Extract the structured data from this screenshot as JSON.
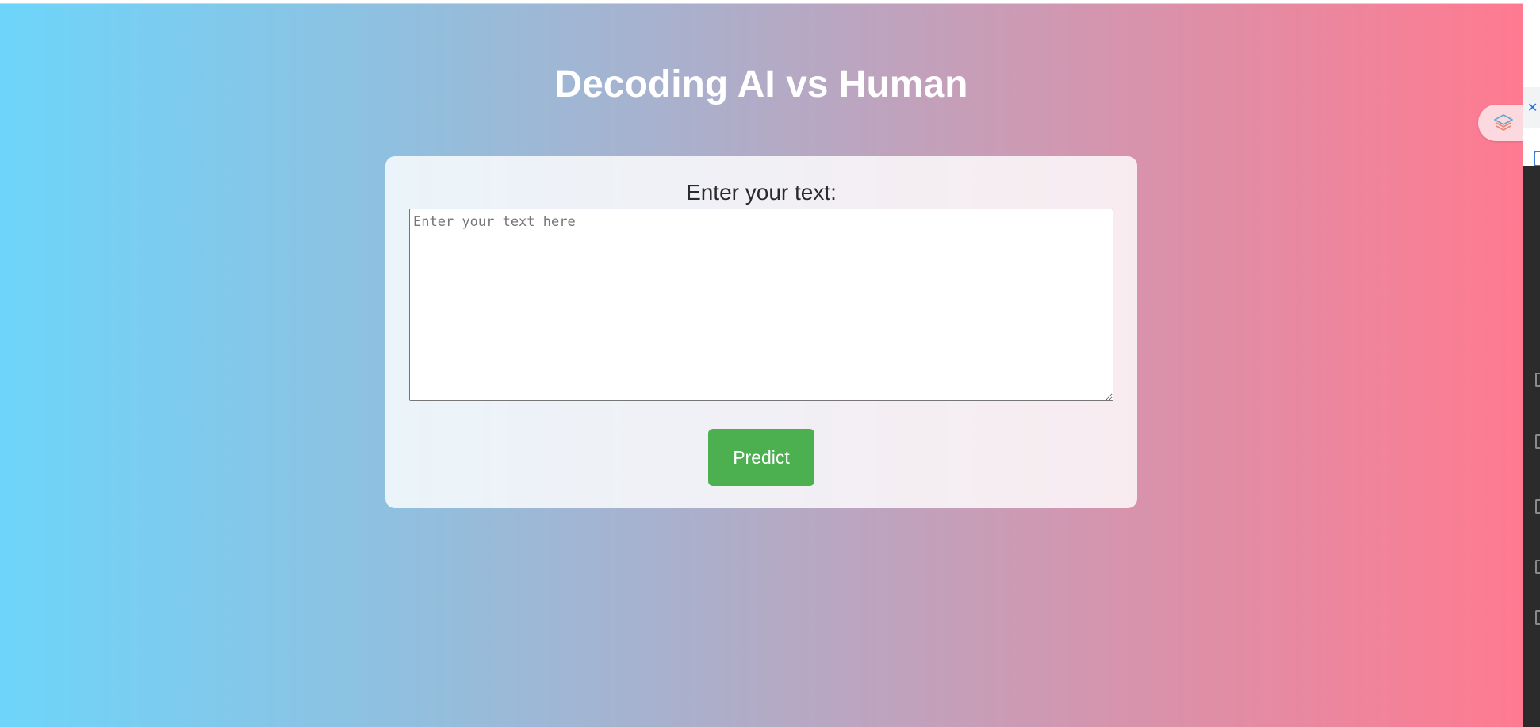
{
  "page": {
    "title": "Decoding AI vs Human"
  },
  "form": {
    "label": "Enter your text:",
    "text_input": {
      "value": "",
      "placeholder": "Enter your text here"
    },
    "predict_label": "Predict"
  },
  "colors": {
    "gradient_start": "#6dd5fa",
    "gradient_end": "#ff7a90",
    "button": "#4caf50"
  },
  "icons": {
    "extension": "extension-layers-icon",
    "devtools_close": "close-icon"
  }
}
